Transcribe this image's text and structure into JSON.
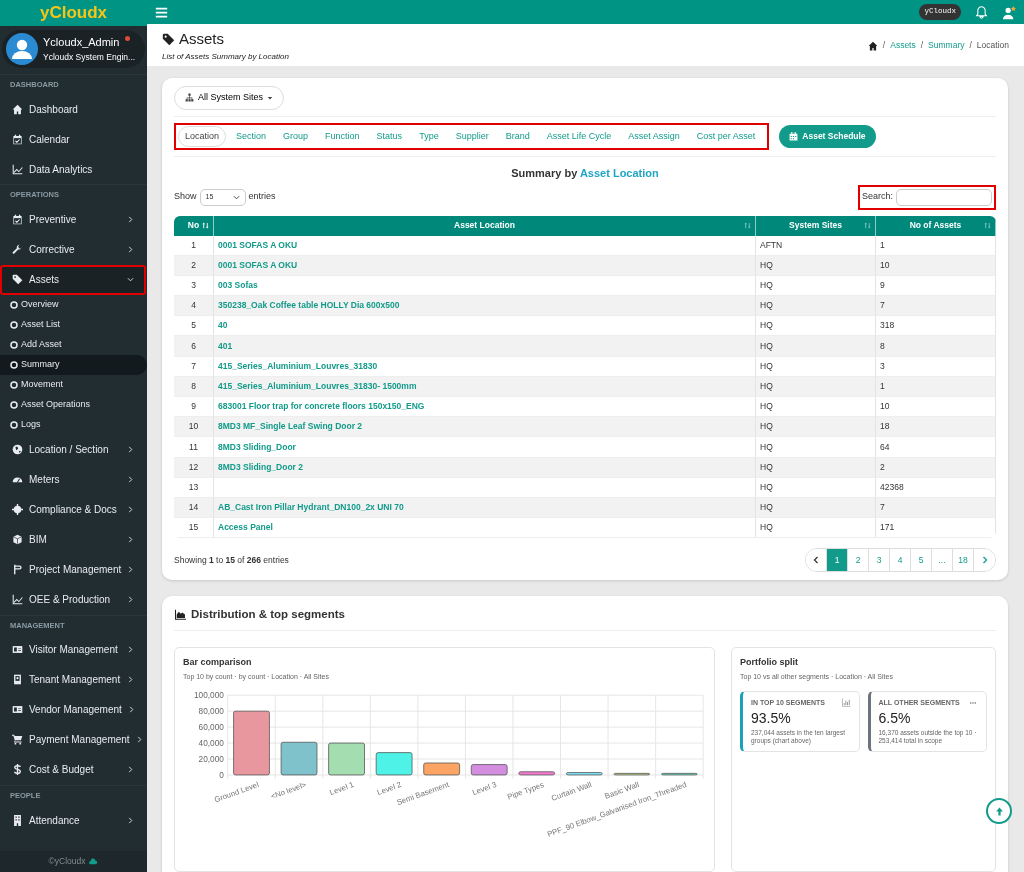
{
  "brand": {
    "logo": "yCloudx"
  },
  "user": {
    "name": "Ycloudx_Admin",
    "role": "Ycloudx System Engin...",
    "online": true
  },
  "sidebar": {
    "sections": [
      {
        "label": "DASHBOARD",
        "items": [
          {
            "label": "Dashboard",
            "has_submenu": false,
            "highlighted": false
          },
          {
            "label": "Calendar",
            "has_submenu": false,
            "highlighted": false
          },
          {
            "label": "Data Analytics",
            "has_submenu": false,
            "highlighted": false
          }
        ]
      },
      {
        "label": "OPERATIONS",
        "items": [
          {
            "label": "Preventive",
            "has_submenu": true,
            "expanded": false,
            "highlighted": false
          },
          {
            "label": "Corrective",
            "has_submenu": true,
            "expanded": false,
            "highlighted": false
          },
          {
            "label": "Assets",
            "has_submenu": true,
            "expanded": true,
            "highlighted": true,
            "children": [
              {
                "label": "Overview",
                "selected": false
              },
              {
                "label": "Asset List",
                "selected": false
              },
              {
                "label": "Add Asset",
                "selected": false
              },
              {
                "label": "Summary",
                "selected": true
              },
              {
                "label": "Movement",
                "selected": false
              },
              {
                "label": "Asset Operations",
                "selected": false
              },
              {
                "label": "Logs",
                "selected": false
              }
            ]
          },
          {
            "label": "Location / Section",
            "has_submenu": true,
            "expanded": false,
            "highlighted": false
          },
          {
            "label": "Meters",
            "has_submenu": true,
            "expanded": false,
            "highlighted": false
          },
          {
            "label": "Compliance & Docs",
            "has_submenu": true,
            "expanded": false,
            "highlighted": false
          },
          {
            "label": "BIM",
            "has_submenu": true,
            "expanded": false,
            "highlighted": false
          },
          {
            "label": "Project Management",
            "has_submenu": true,
            "expanded": false,
            "highlighted": false
          },
          {
            "label": "OEE & Production",
            "has_submenu": true,
            "expanded": false,
            "highlighted": false
          }
        ]
      },
      {
        "label": "MANAGEMENT",
        "items": [
          {
            "label": "Visitor Management",
            "has_submenu": true,
            "expanded": false,
            "highlighted": false
          },
          {
            "label": "Tenant Management",
            "has_submenu": true,
            "expanded": false,
            "highlighted": false
          },
          {
            "label": "Vendor Management",
            "has_submenu": true,
            "expanded": false,
            "highlighted": false
          },
          {
            "label": "Payment Management",
            "has_submenu": true,
            "expanded": false,
            "highlighted": false
          },
          {
            "label": "Cost & Budget",
            "has_submenu": true,
            "expanded": false,
            "highlighted": false
          }
        ]
      },
      {
        "label": "PEOPLE",
        "items": [
          {
            "label": "Attendance",
            "has_submenu": true,
            "expanded": false,
            "highlighted": false
          }
        ]
      }
    ],
    "footer": "©yCloudx"
  },
  "topbar": {
    "tenant_badge": "yCloudx",
    "notification_dot": true
  },
  "page": {
    "title": "Assets",
    "subtitle": "List of Assets Summary by Location",
    "breadcrumb": [
      "Assets",
      "Summary",
      "Location"
    ],
    "breadcrumb_separator": "/"
  },
  "filters": {
    "site_dropdown": "All System Sites",
    "tabs_highlighted": true,
    "tabs": [
      {
        "label": "Location",
        "selected": true
      },
      {
        "label": "Section",
        "selected": false
      },
      {
        "label": "Group",
        "selected": false
      },
      {
        "label": "Function",
        "selected": false
      },
      {
        "label": "Status",
        "selected": false
      },
      {
        "label": "Type",
        "selected": false
      },
      {
        "label": "Supplier",
        "selected": false
      },
      {
        "label": "Brand",
        "selected": false
      },
      {
        "label": "Asset Life Cycle",
        "selected": false
      },
      {
        "label": "Asset Assign",
        "selected": false
      },
      {
        "label": "Cost per Asset",
        "selected": false
      }
    ],
    "schedule_button": "Asset Schedule"
  },
  "summary": {
    "title": "Summary by ",
    "title_link": "Asset Location",
    "show_label": "Show",
    "page_size": "15",
    "entries_label": "entries",
    "search_label": "Search:",
    "search_highlighted": true
  },
  "table": {
    "columns": [
      "No",
      "Asset Location",
      "System Sites",
      "No of Assets"
    ],
    "rows": [
      [
        "1",
        "0001 SOFAS A OKU",
        "AFTN",
        "1"
      ],
      [
        "2",
        "0001 SOFAS A OKU",
        "HQ",
        "10"
      ],
      [
        "3",
        "003 Sofas",
        "HQ",
        "9"
      ],
      [
        "4",
        "350238_Oak Coffee table HOLLY Dia 600x500",
        "HQ",
        "7"
      ],
      [
        "5",
        "40",
        "HQ",
        "318"
      ],
      [
        "6",
        "401",
        "HQ",
        "8"
      ],
      [
        "7",
        "415_Series_Aluminium_Louvres_31830",
        "HQ",
        "3"
      ],
      [
        "8",
        "415_Series_Aluminium_Louvres_31830- 1500mm",
        "HQ",
        "1"
      ],
      [
        "9",
        "683001 Floor trap for concrete floors 150x150_ENG",
        "HQ",
        "10"
      ],
      [
        "10",
        "8MD3 MF_Single Leaf Swing Door 2",
        "HQ",
        "18"
      ],
      [
        "11",
        "8MD3 Sliding_Door",
        "HQ",
        "64"
      ],
      [
        "12",
        "8MD3 Sliding_Door 2",
        "HQ",
        "2"
      ],
      [
        "13",
        "",
        "HQ",
        "42368"
      ],
      [
        "14",
        "AB_Cast Iron Pillar Hydrant_DN100_2x UNI 70",
        "HQ",
        "7"
      ],
      [
        "15",
        "Access Panel",
        "HQ",
        "171"
      ]
    ],
    "info": "Showing **1** to **15** of **266** entries",
    "pages": [
      {
        "label": "1",
        "selected": true
      },
      {
        "label": "2",
        "selected": false
      },
      {
        "label": "3",
        "selected": false
      },
      {
        "label": "4",
        "selected": false
      },
      {
        "label": "5",
        "selected": false
      },
      {
        "label": "...",
        "selected": false
      },
      {
        "label": "18",
        "selected": false
      }
    ]
  },
  "distribution": {
    "title": "Distribution & top segments",
    "bar_panel": {
      "title": "Bar comparison",
      "subtitle": "Top 10 by count · by count · Location · All Sites",
      "chart_data": {
        "type": "bar",
        "categories": [
          "Ground Level",
          "<No level>",
          "Level 1",
          "Level 2",
          "Semi Basement",
          "Level 3",
          "Pipe Types",
          "Curtain Wall",
          "Basic Wall",
          "PPF_90 Elbow_Galvanised Iron_Threaded"
        ],
        "grid": true,
        "series": [
          {
            "color": "#e8979f",
            "values": [
              80000,
              null,
              null,
              null,
              null,
              null,
              null,
              null,
              null,
              null
            ]
          },
          {
            "color": "#7fc2cc",
            "values": [
              null,
              41000,
              null,
              null,
              null,
              null,
              null,
              null,
              null,
              null
            ]
          },
          {
            "color": "#a3ddb0",
            "values": [
              null,
              null,
              40000,
              null,
              null,
              null,
              null,
              null,
              null,
              null
            ]
          },
          {
            "color": "#4ff2e6",
            "values": [
              null,
              null,
              null,
              28000,
              null,
              null,
              null,
              null,
              null,
              null
            ]
          },
          {
            "color": "#fca463",
            "values": [
              null,
              null,
              null,
              null,
              15000,
              null,
              null,
              null,
              null,
              null
            ]
          },
          {
            "color": "#d48ee0",
            "values": [
              null,
              null,
              null,
              null,
              null,
              13000,
              null,
              null,
              null,
              null
            ]
          },
          {
            "color": "#f37bd0",
            "values": [
              null,
              null,
              null,
              null,
              null,
              null,
              4000,
              null,
              null,
              null
            ]
          },
          {
            "color": "#7fe3f7",
            "values": [
              null,
              null,
              null,
              null,
              null,
              null,
              null,
              3000,
              null,
              null
            ]
          },
          {
            "color": "#c2d68a",
            "values": [
              null,
              null,
              null,
              null,
              null,
              null,
              null,
              null,
              2000,
              null
            ]
          },
          {
            "color": "#6fe0c9",
            "values": [
              null,
              null,
              null,
              null,
              null,
              null,
              null,
              null,
              null,
              2000
            ]
          }
        ],
        "ylim": [
          0,
          100000
        ],
        "yticks": [
          {
            "value": 0,
            "label": "0"
          },
          {
            "value": 20000,
            "label": "20,000"
          },
          {
            "value": 40000,
            "label": "40,000"
          },
          {
            "value": 60000,
            "label": "60,000"
          },
          {
            "value": 80000,
            "label": "80,000"
          },
          {
            "value": 100000,
            "label": "100,000"
          }
        ]
      }
    },
    "split_panel": {
      "title": "Portfolio split",
      "subtitle": "Top 10 vs all other segments · Location · All Sites",
      "cards": [
        {
          "kind": "top",
          "label": "IN TOP 10 SEGMENTS",
          "value": "93.5%",
          "note": "237,044 assets in the ten largest groups (chart above)",
          "color": "#17a2b8"
        },
        {
          "kind": "other",
          "label": "ALL OTHER SEGMENTS",
          "value": "6.5%",
          "note": "16,370 assets outside the top 10 · 253,414 total in scope",
          "color": "#6c757d"
        }
      ]
    }
  }
}
